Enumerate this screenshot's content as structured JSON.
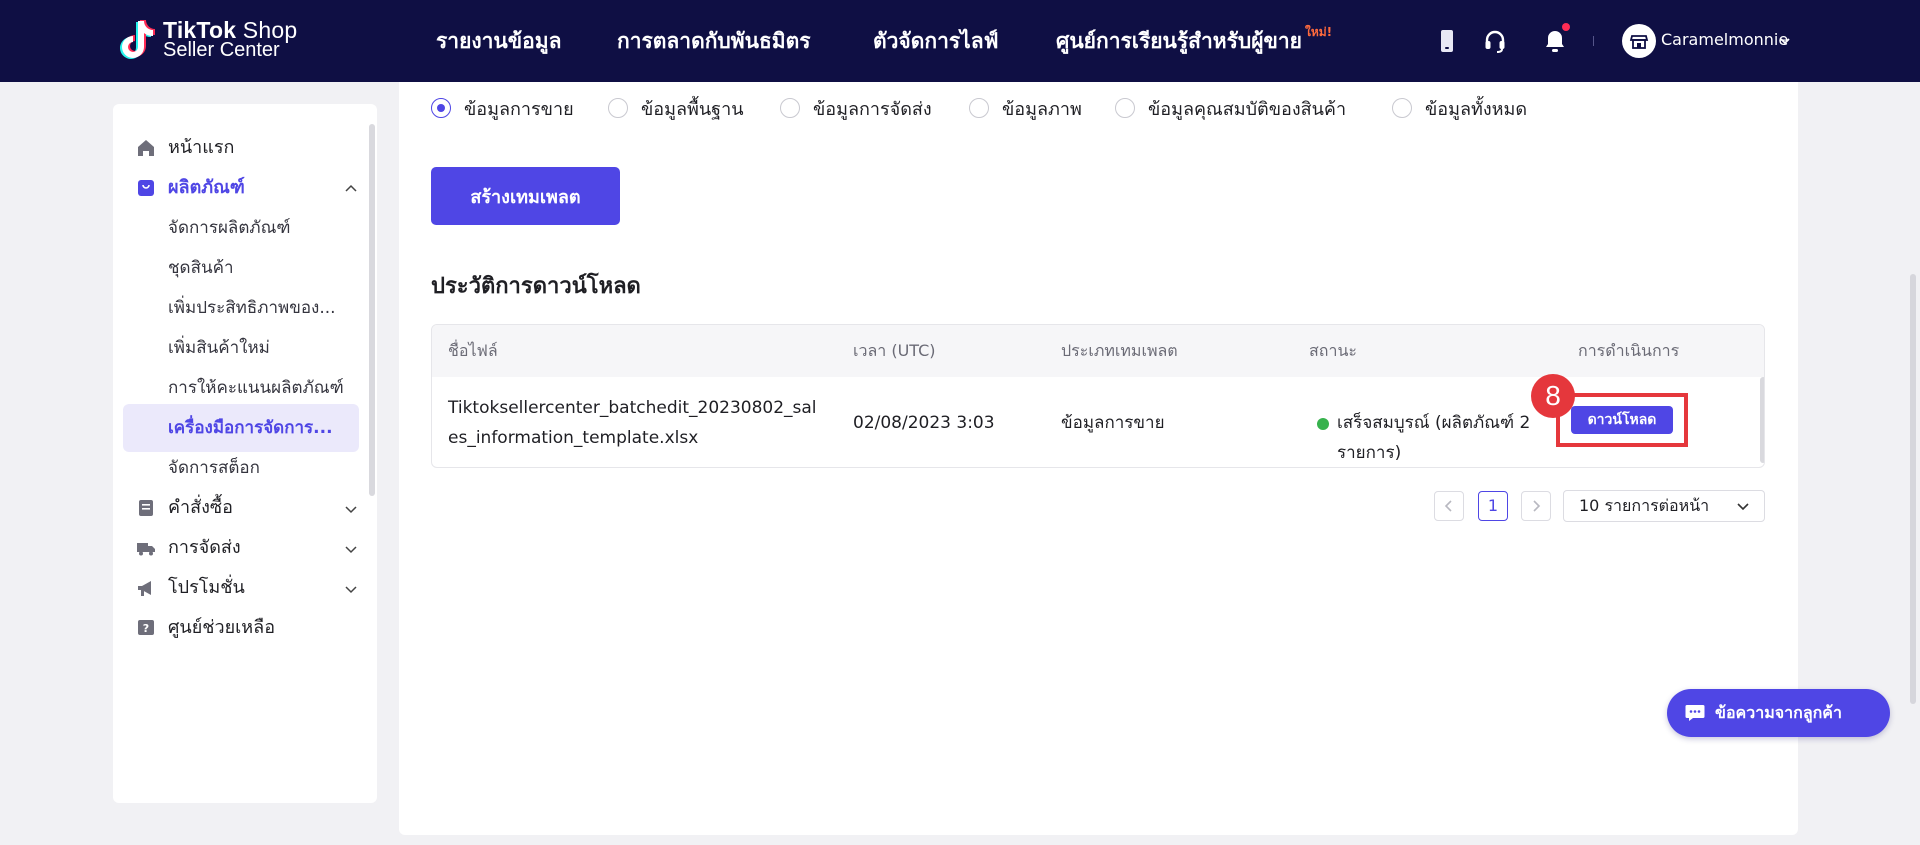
{
  "header": {
    "logo_line1": "TikTok",
    "logo_line1b": " Shop",
    "logo_line2": "Seller Center",
    "nav": [
      {
        "label": "รายงานข้อมูล"
      },
      {
        "label": "การตลาดกับพันธมิตร"
      },
      {
        "label": "ตัวจัดการไลฟ์"
      },
      {
        "label": "ศูนย์การเรียนรู้สำหรับผู้ขาย",
        "badge": "ใหม่!"
      }
    ],
    "icons": [
      "mobile-icon",
      "headset-icon",
      "bell-icon"
    ],
    "user_name": "Caramelmonnie"
  },
  "sidebar": {
    "items": [
      {
        "label": "หน้าแรก",
        "icon": "home-icon"
      },
      {
        "label": "ผลิตภัณฑ์",
        "icon": "shopping-bag-icon",
        "expanded": true
      },
      {
        "label": "คำสั่งซื้อ",
        "icon": "document-icon"
      },
      {
        "label": "การจัดส่ง",
        "icon": "truck-icon"
      },
      {
        "label": "โปรโมชั่น",
        "icon": "megaphone-icon"
      },
      {
        "label": "ศูนย์ช่วยเหลือ",
        "icon": "help-icon"
      }
    ],
    "subitems": [
      {
        "label": "จัดการผลิตภัณฑ์"
      },
      {
        "label": "ชุดสินค้า"
      },
      {
        "label": "เพิ่มประสิทธิภาพของ..."
      },
      {
        "label": "เพิ่มสินค้าใหม่"
      },
      {
        "label": "การให้คะแนนผลิตภัณฑ์"
      },
      {
        "label": "เครื่องมือการจัดการ...",
        "active": true
      },
      {
        "label": "จัดการสต็อก"
      }
    ]
  },
  "main": {
    "radios": [
      {
        "label": "ข้อมูลการขาย",
        "selected": true
      },
      {
        "label": "ข้อมูลพื้นฐาน"
      },
      {
        "label": "ข้อมูลการจัดส่ง"
      },
      {
        "label": "ข้อมูลภาพ"
      },
      {
        "label": "ข้อมูลคุณสมบัติของสินค้า"
      },
      {
        "label": "ข้อมูลทั้งหมด"
      }
    ],
    "create_button": "สร้างเทมเพลต",
    "history_title": "ประวัติการดาวน์โหลด",
    "table": {
      "columns": [
        "ชื่อไฟล์",
        "เวลา (UTC)",
        "ประเภทเทมเพลต",
        "สถานะ",
        "การดำเนินการ"
      ],
      "rows": [
        {
          "file_line1": "Tiktoksellercenter_batchedit_20230802_sal",
          "file_line2": "es_information_template.xlsx",
          "time": "02/08/2023 3:03",
          "type": "ข้อมูลการขาย",
          "status_line1": "เสร็จสมบูรณ์ (ผลิตภัณฑ์ 2",
          "status_line2": "รายการ)",
          "action": "ดาวน์โหลด"
        }
      ]
    },
    "step_badge": "8",
    "pagination": {
      "current": "1",
      "page_size": "10 รายการต่อหน้า"
    }
  },
  "chat": {
    "label": "ข้อความจากลูกค้า"
  },
  "colors": {
    "accent": "#4f46e5",
    "header_bg": "#0f0f44",
    "highlight": "#e5373c",
    "success": "#37b24d"
  }
}
